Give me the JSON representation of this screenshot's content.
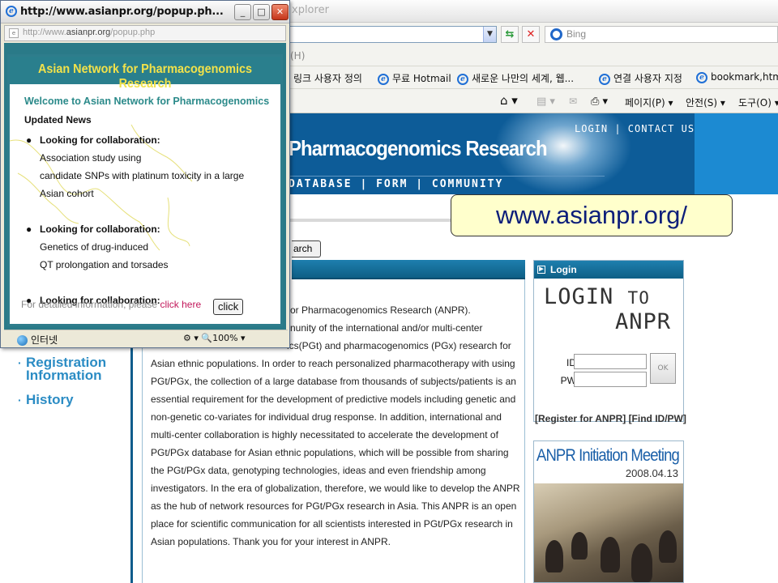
{
  "main_window": {
    "title_fragment": "xplorer",
    "search_placeholder": "Bing",
    "menu_help": "(H)",
    "links": [
      {
        "label": "링크 사용자 정의"
      },
      {
        "label": "무료 Hotmail"
      },
      {
        "label": "새로운 나만의 세계, 웹..."
      },
      {
        "label": "연결 사용자 지정"
      },
      {
        "label": "bookmark,htm"
      }
    ],
    "tools": [
      {
        "label": "페이지(P)"
      },
      {
        "label": "안전(S)"
      },
      {
        "label": "도구(O)"
      }
    ]
  },
  "site": {
    "title": "Pharmacogenomics Research",
    "top_links": "LOGIN | CONTACT US",
    "nav": "DATABASE | FORM | COMMUNITY",
    "search_label": "arch",
    "url_callout": "www.asianpr.org/",
    "content": {
      "line1": "or Pharmacogenomics Research (ANPR).",
      "line2": "nunity of the international and/or multi-center",
      "line3": "ics(PGt) and pharmacogenomics (PGx) research for",
      "body": "Asian ethnic populations. In order to reach personalized pharmacotherapy with using PGt/PGx, the collection of a large database from thousands of subjects/patients is an essential requirement for the development of predictive models including genetic and non-genetic co-variates for individual drug response. In addition, international and multi-center collaboration is highly necessitated to accelerate the development of PGt/PGx database for Asian ethnic populations, which will be possible from sharing the PGt/PGx data, genotyping technologies, ideas and even friendship among investigators. In the era of globalization, therefore, we would like to develop the ANPR as the hub of network resources for PGt/PGx research in Asia. This ANPR is an open place for scientific communication for all scientists interested in PGt/PGx research in Asian populations. Thank you for your interest in ANPR."
    },
    "side_links": [
      {
        "label": "Registration Information"
      },
      {
        "label": "History"
      }
    ],
    "login": {
      "header": "Login",
      "banner_login": "LOGIN",
      "banner_to": "TO",
      "banner_anpr": "ANPR",
      "id_label": "ID",
      "pw_label": "PW",
      "ok_label": "OK",
      "register_links": "[Register for ANPR] [Find ID/PW]"
    },
    "meeting": {
      "title": "ANPR Initiation Meeting",
      "date": "2008.04.13"
    }
  },
  "popup": {
    "title": "http://www.asianpr.org/popup.ph...",
    "address_prefix": "http://www.",
    "address_domain": "asianpr.org",
    "address_suffix": "/popup.php",
    "banner": "Asian Network for Pharmacogenomics Research",
    "welcome": "Welcome to Asian Network for Pharmacogenomics",
    "updated_news": "Updated News",
    "news": [
      {
        "head": "Looking for collaboration:",
        "lines": [
          "Association study using",
          "candidate SNPs with platinum toxicity in a large",
          "Asian cohort"
        ]
      },
      {
        "head": "Looking for collaboration:",
        "lines": [
          "Genetics of drug-induced",
          "QT prolongation and torsades"
        ]
      },
      {
        "head": "Looking for collaboration:",
        "lines": []
      }
    ],
    "footer_text": "For detailed information, please ",
    "footer_link": "click here",
    "click_button": "click",
    "status_zone": "인터넷",
    "status_zoom": "100%"
  }
}
